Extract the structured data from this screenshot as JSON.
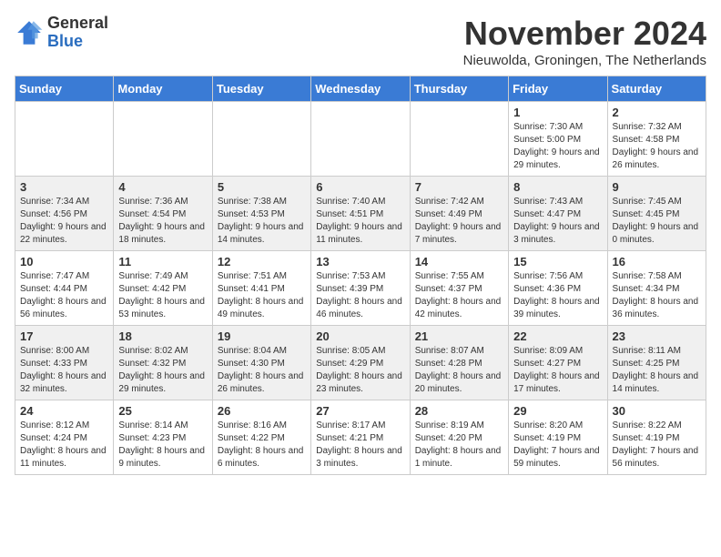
{
  "header": {
    "logo_general": "General",
    "logo_blue": "Blue",
    "month_title": "November 2024",
    "subtitle": "Nieuwolda, Groningen, The Netherlands"
  },
  "days_of_week": [
    "Sunday",
    "Monday",
    "Tuesday",
    "Wednesday",
    "Thursday",
    "Friday",
    "Saturday"
  ],
  "weeks": [
    [
      {
        "day": "",
        "info": ""
      },
      {
        "day": "",
        "info": ""
      },
      {
        "day": "",
        "info": ""
      },
      {
        "day": "",
        "info": ""
      },
      {
        "day": "",
        "info": ""
      },
      {
        "day": "1",
        "info": "Sunrise: 7:30 AM\nSunset: 5:00 PM\nDaylight: 9 hours and 29 minutes."
      },
      {
        "day": "2",
        "info": "Sunrise: 7:32 AM\nSunset: 4:58 PM\nDaylight: 9 hours and 26 minutes."
      }
    ],
    [
      {
        "day": "3",
        "info": "Sunrise: 7:34 AM\nSunset: 4:56 PM\nDaylight: 9 hours and 22 minutes."
      },
      {
        "day": "4",
        "info": "Sunrise: 7:36 AM\nSunset: 4:54 PM\nDaylight: 9 hours and 18 minutes."
      },
      {
        "day": "5",
        "info": "Sunrise: 7:38 AM\nSunset: 4:53 PM\nDaylight: 9 hours and 14 minutes."
      },
      {
        "day": "6",
        "info": "Sunrise: 7:40 AM\nSunset: 4:51 PM\nDaylight: 9 hours and 11 minutes."
      },
      {
        "day": "7",
        "info": "Sunrise: 7:42 AM\nSunset: 4:49 PM\nDaylight: 9 hours and 7 minutes."
      },
      {
        "day": "8",
        "info": "Sunrise: 7:43 AM\nSunset: 4:47 PM\nDaylight: 9 hours and 3 minutes."
      },
      {
        "day": "9",
        "info": "Sunrise: 7:45 AM\nSunset: 4:45 PM\nDaylight: 9 hours and 0 minutes."
      }
    ],
    [
      {
        "day": "10",
        "info": "Sunrise: 7:47 AM\nSunset: 4:44 PM\nDaylight: 8 hours and 56 minutes."
      },
      {
        "day": "11",
        "info": "Sunrise: 7:49 AM\nSunset: 4:42 PM\nDaylight: 8 hours and 53 minutes."
      },
      {
        "day": "12",
        "info": "Sunrise: 7:51 AM\nSunset: 4:41 PM\nDaylight: 8 hours and 49 minutes."
      },
      {
        "day": "13",
        "info": "Sunrise: 7:53 AM\nSunset: 4:39 PM\nDaylight: 8 hours and 46 minutes."
      },
      {
        "day": "14",
        "info": "Sunrise: 7:55 AM\nSunset: 4:37 PM\nDaylight: 8 hours and 42 minutes."
      },
      {
        "day": "15",
        "info": "Sunrise: 7:56 AM\nSunset: 4:36 PM\nDaylight: 8 hours and 39 minutes."
      },
      {
        "day": "16",
        "info": "Sunrise: 7:58 AM\nSunset: 4:34 PM\nDaylight: 8 hours and 36 minutes."
      }
    ],
    [
      {
        "day": "17",
        "info": "Sunrise: 8:00 AM\nSunset: 4:33 PM\nDaylight: 8 hours and 32 minutes."
      },
      {
        "day": "18",
        "info": "Sunrise: 8:02 AM\nSunset: 4:32 PM\nDaylight: 8 hours and 29 minutes."
      },
      {
        "day": "19",
        "info": "Sunrise: 8:04 AM\nSunset: 4:30 PM\nDaylight: 8 hours and 26 minutes."
      },
      {
        "day": "20",
        "info": "Sunrise: 8:05 AM\nSunset: 4:29 PM\nDaylight: 8 hours and 23 minutes."
      },
      {
        "day": "21",
        "info": "Sunrise: 8:07 AM\nSunset: 4:28 PM\nDaylight: 8 hours and 20 minutes."
      },
      {
        "day": "22",
        "info": "Sunrise: 8:09 AM\nSunset: 4:27 PM\nDaylight: 8 hours and 17 minutes."
      },
      {
        "day": "23",
        "info": "Sunrise: 8:11 AM\nSunset: 4:25 PM\nDaylight: 8 hours and 14 minutes."
      }
    ],
    [
      {
        "day": "24",
        "info": "Sunrise: 8:12 AM\nSunset: 4:24 PM\nDaylight: 8 hours and 11 minutes."
      },
      {
        "day": "25",
        "info": "Sunrise: 8:14 AM\nSunset: 4:23 PM\nDaylight: 8 hours and 9 minutes."
      },
      {
        "day": "26",
        "info": "Sunrise: 8:16 AM\nSunset: 4:22 PM\nDaylight: 8 hours and 6 minutes."
      },
      {
        "day": "27",
        "info": "Sunrise: 8:17 AM\nSunset: 4:21 PM\nDaylight: 8 hours and 3 minutes."
      },
      {
        "day": "28",
        "info": "Sunrise: 8:19 AM\nSunset: 4:20 PM\nDaylight: 8 hours and 1 minute."
      },
      {
        "day": "29",
        "info": "Sunrise: 8:20 AM\nSunset: 4:19 PM\nDaylight: 7 hours and 59 minutes."
      },
      {
        "day": "30",
        "info": "Sunrise: 8:22 AM\nSunset: 4:19 PM\nDaylight: 7 hours and 56 minutes."
      }
    ]
  ]
}
